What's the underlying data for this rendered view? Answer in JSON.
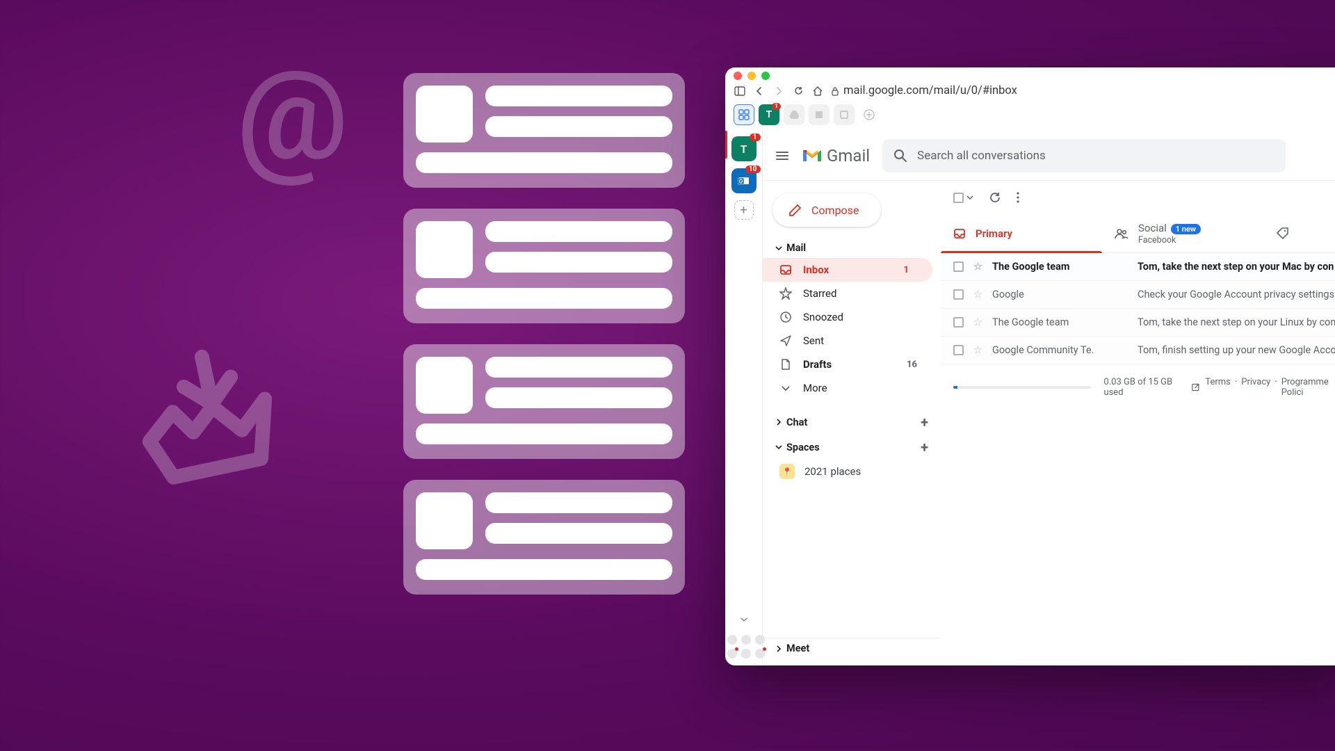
{
  "browser": {
    "url": "mail.google.com/mail/u/0/#inbox",
    "tabs": [
      {
        "letter": "T",
        "badge": "1",
        "bg": "#0b8063"
      }
    ]
  },
  "rail": {
    "items": [
      {
        "name": "teams",
        "letter": "T",
        "badge": "1",
        "bg": "#0b8063"
      },
      {
        "name": "outlook",
        "letter": "",
        "badge": "10",
        "bg": "#0f6cbd"
      }
    ]
  },
  "header": {
    "brand": "Gmail",
    "search_placeholder": "Search all conversations"
  },
  "compose": "Compose",
  "sections": {
    "mail": "Mail",
    "chat": "Chat",
    "spaces": "Spaces",
    "meet": "Meet"
  },
  "nav": [
    {
      "key": "inbox",
      "label": "Inbox",
      "count": "1",
      "active": true,
      "bold": true
    },
    {
      "key": "starred",
      "label": "Starred"
    },
    {
      "key": "snoozed",
      "label": "Snoozed"
    },
    {
      "key": "sent",
      "label": "Sent"
    },
    {
      "key": "drafts",
      "label": "Drafts",
      "count": "16",
      "bold": true
    },
    {
      "key": "more",
      "label": "More"
    }
  ],
  "spaces": [
    {
      "label": "2021 places"
    }
  ],
  "tabs": {
    "primary": "Primary",
    "social": "Social",
    "social_badge": "1 new",
    "social_sub": "Facebook"
  },
  "emails": [
    {
      "sender": "The Google team",
      "subject": "Tom, take the next step on your Mac by con",
      "unread": true
    },
    {
      "sender": "Google",
      "subject": "Check your Google Account privacy settings",
      "unread": false
    },
    {
      "sender": "The Google team",
      "subject": "Tom, take the next step on your Linux by con",
      "unread": false
    },
    {
      "sender": "Google Community Te.",
      "subject": "Tom, finish setting up your new Google Acco",
      "unread": false
    }
  ],
  "footer": {
    "storage": "0.03 GB of 15 GB used",
    "links": [
      "Terms",
      "Privacy",
      "Programme Polici"
    ]
  }
}
